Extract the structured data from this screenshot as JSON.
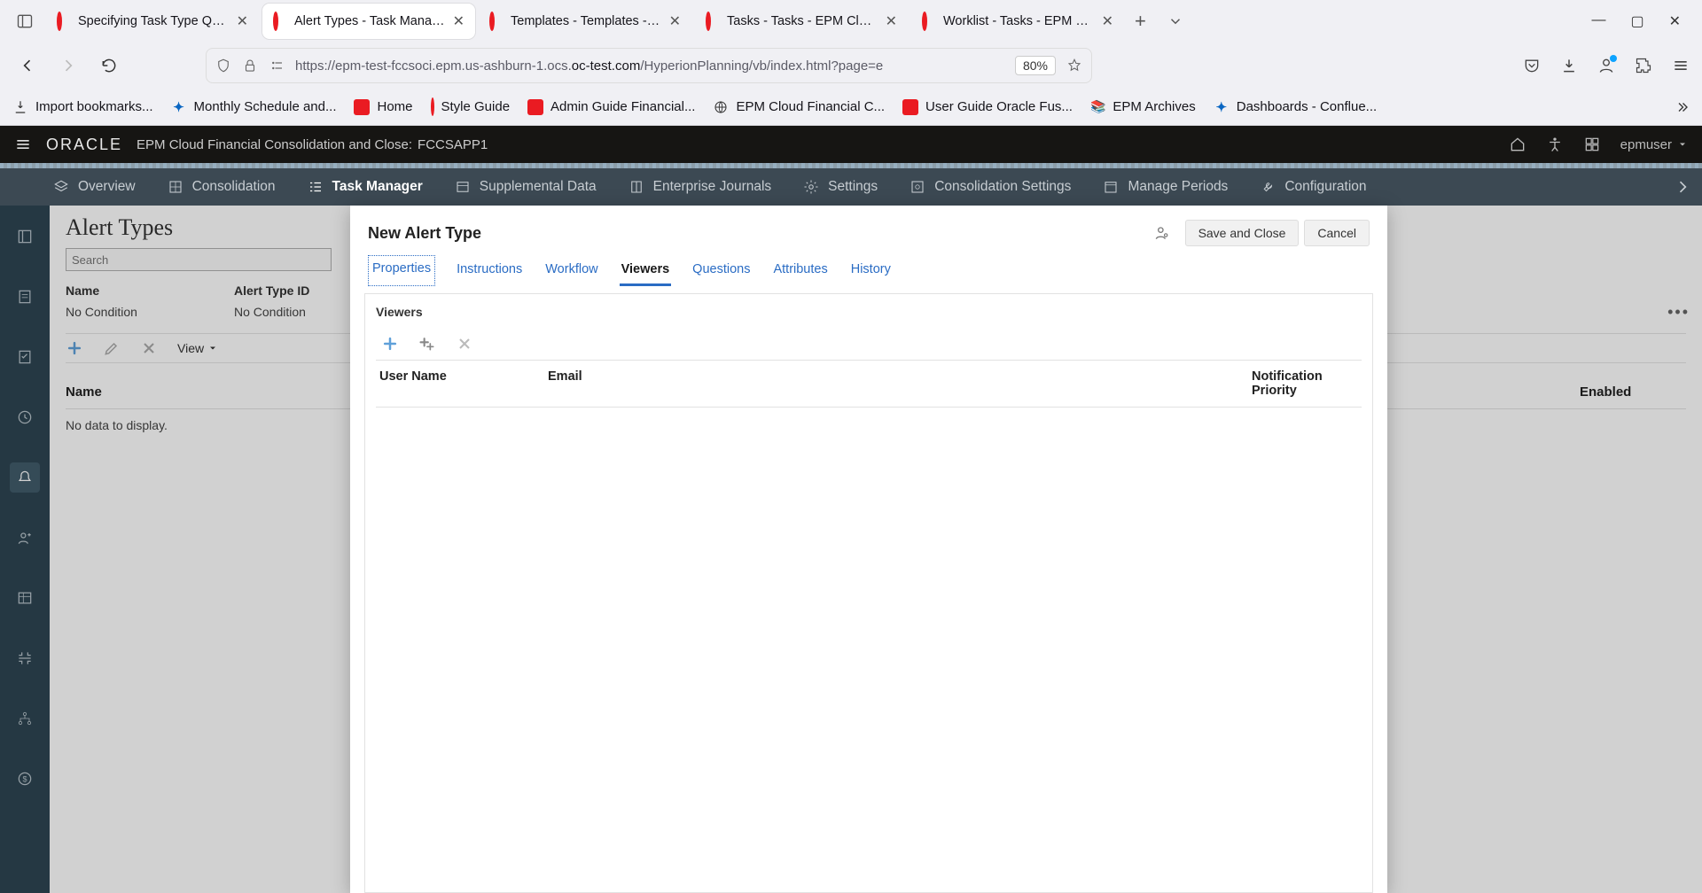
{
  "browser": {
    "tabs": [
      {
        "title": "Specifying Task Type Ques"
      },
      {
        "title": "Alert Types - Task Manage"
      },
      {
        "title": "Templates - Templates - Ta"
      },
      {
        "title": "Tasks - Tasks - EPM Cloud"
      },
      {
        "title": "Worklist - Tasks - EPM Clo"
      }
    ],
    "active_tab_index": 1,
    "url_display_pre": "https://epm-test-fccsoci.epm.us-ashburn-1.ocs.",
    "url_display_bold": "oc-test.com",
    "url_display_post": "/HyperionPlanning/vb/index.html?page=e",
    "zoom": "80%",
    "bookmarks": [
      {
        "label": "Import bookmarks...",
        "icon": "import"
      },
      {
        "label": "Monthly Schedule and...",
        "icon": "confluence"
      },
      {
        "label": "Home",
        "icon": "oracle"
      },
      {
        "label": "Style Guide",
        "icon": "oracle-ring"
      },
      {
        "label": "Admin Guide Financial...",
        "icon": "oracle"
      },
      {
        "label": "EPM Cloud Financial C...",
        "icon": "globe"
      },
      {
        "label": "User Guide Oracle Fus...",
        "icon": "oracle"
      },
      {
        "label": "EPM Archives",
        "icon": "books"
      },
      {
        "label": "Dashboards - Conflue...",
        "icon": "confluence"
      }
    ]
  },
  "app": {
    "brand": "ORACLE",
    "product": "EPM Cloud Financial Consolidation and Close:",
    "app_name": "FCCSAPP1",
    "user": "epmuser",
    "modules": [
      "Overview",
      "Consolidation",
      "Task Manager",
      "Supplemental Data",
      "Enterprise Journals",
      "Settings",
      "Consolidation Settings",
      "Manage Periods",
      "Configuration"
    ],
    "active_module_index": 2
  },
  "under_page": {
    "title": "Alert Types",
    "search_placeholder": "Search",
    "grid": {
      "headers": [
        "Name",
        "Alert Type ID"
      ],
      "row": [
        "No Condition",
        "No Condition"
      ]
    },
    "view_label": "View",
    "main_headers": {
      "name": "Name",
      "enabled": "Enabled"
    },
    "nodata": "No data to display."
  },
  "dialog": {
    "title": "New Alert Type",
    "save_label": "Save and Close",
    "cancel_label": "Cancel",
    "tabs": [
      "Properties",
      "Instructions",
      "Workflow",
      "Viewers",
      "Questions",
      "Attributes",
      "History"
    ],
    "active_tab_index": 3,
    "section_title": "Viewers",
    "table_headers": {
      "user": "User Name",
      "email": "Email",
      "notification_priority": "Notification Priority"
    }
  }
}
